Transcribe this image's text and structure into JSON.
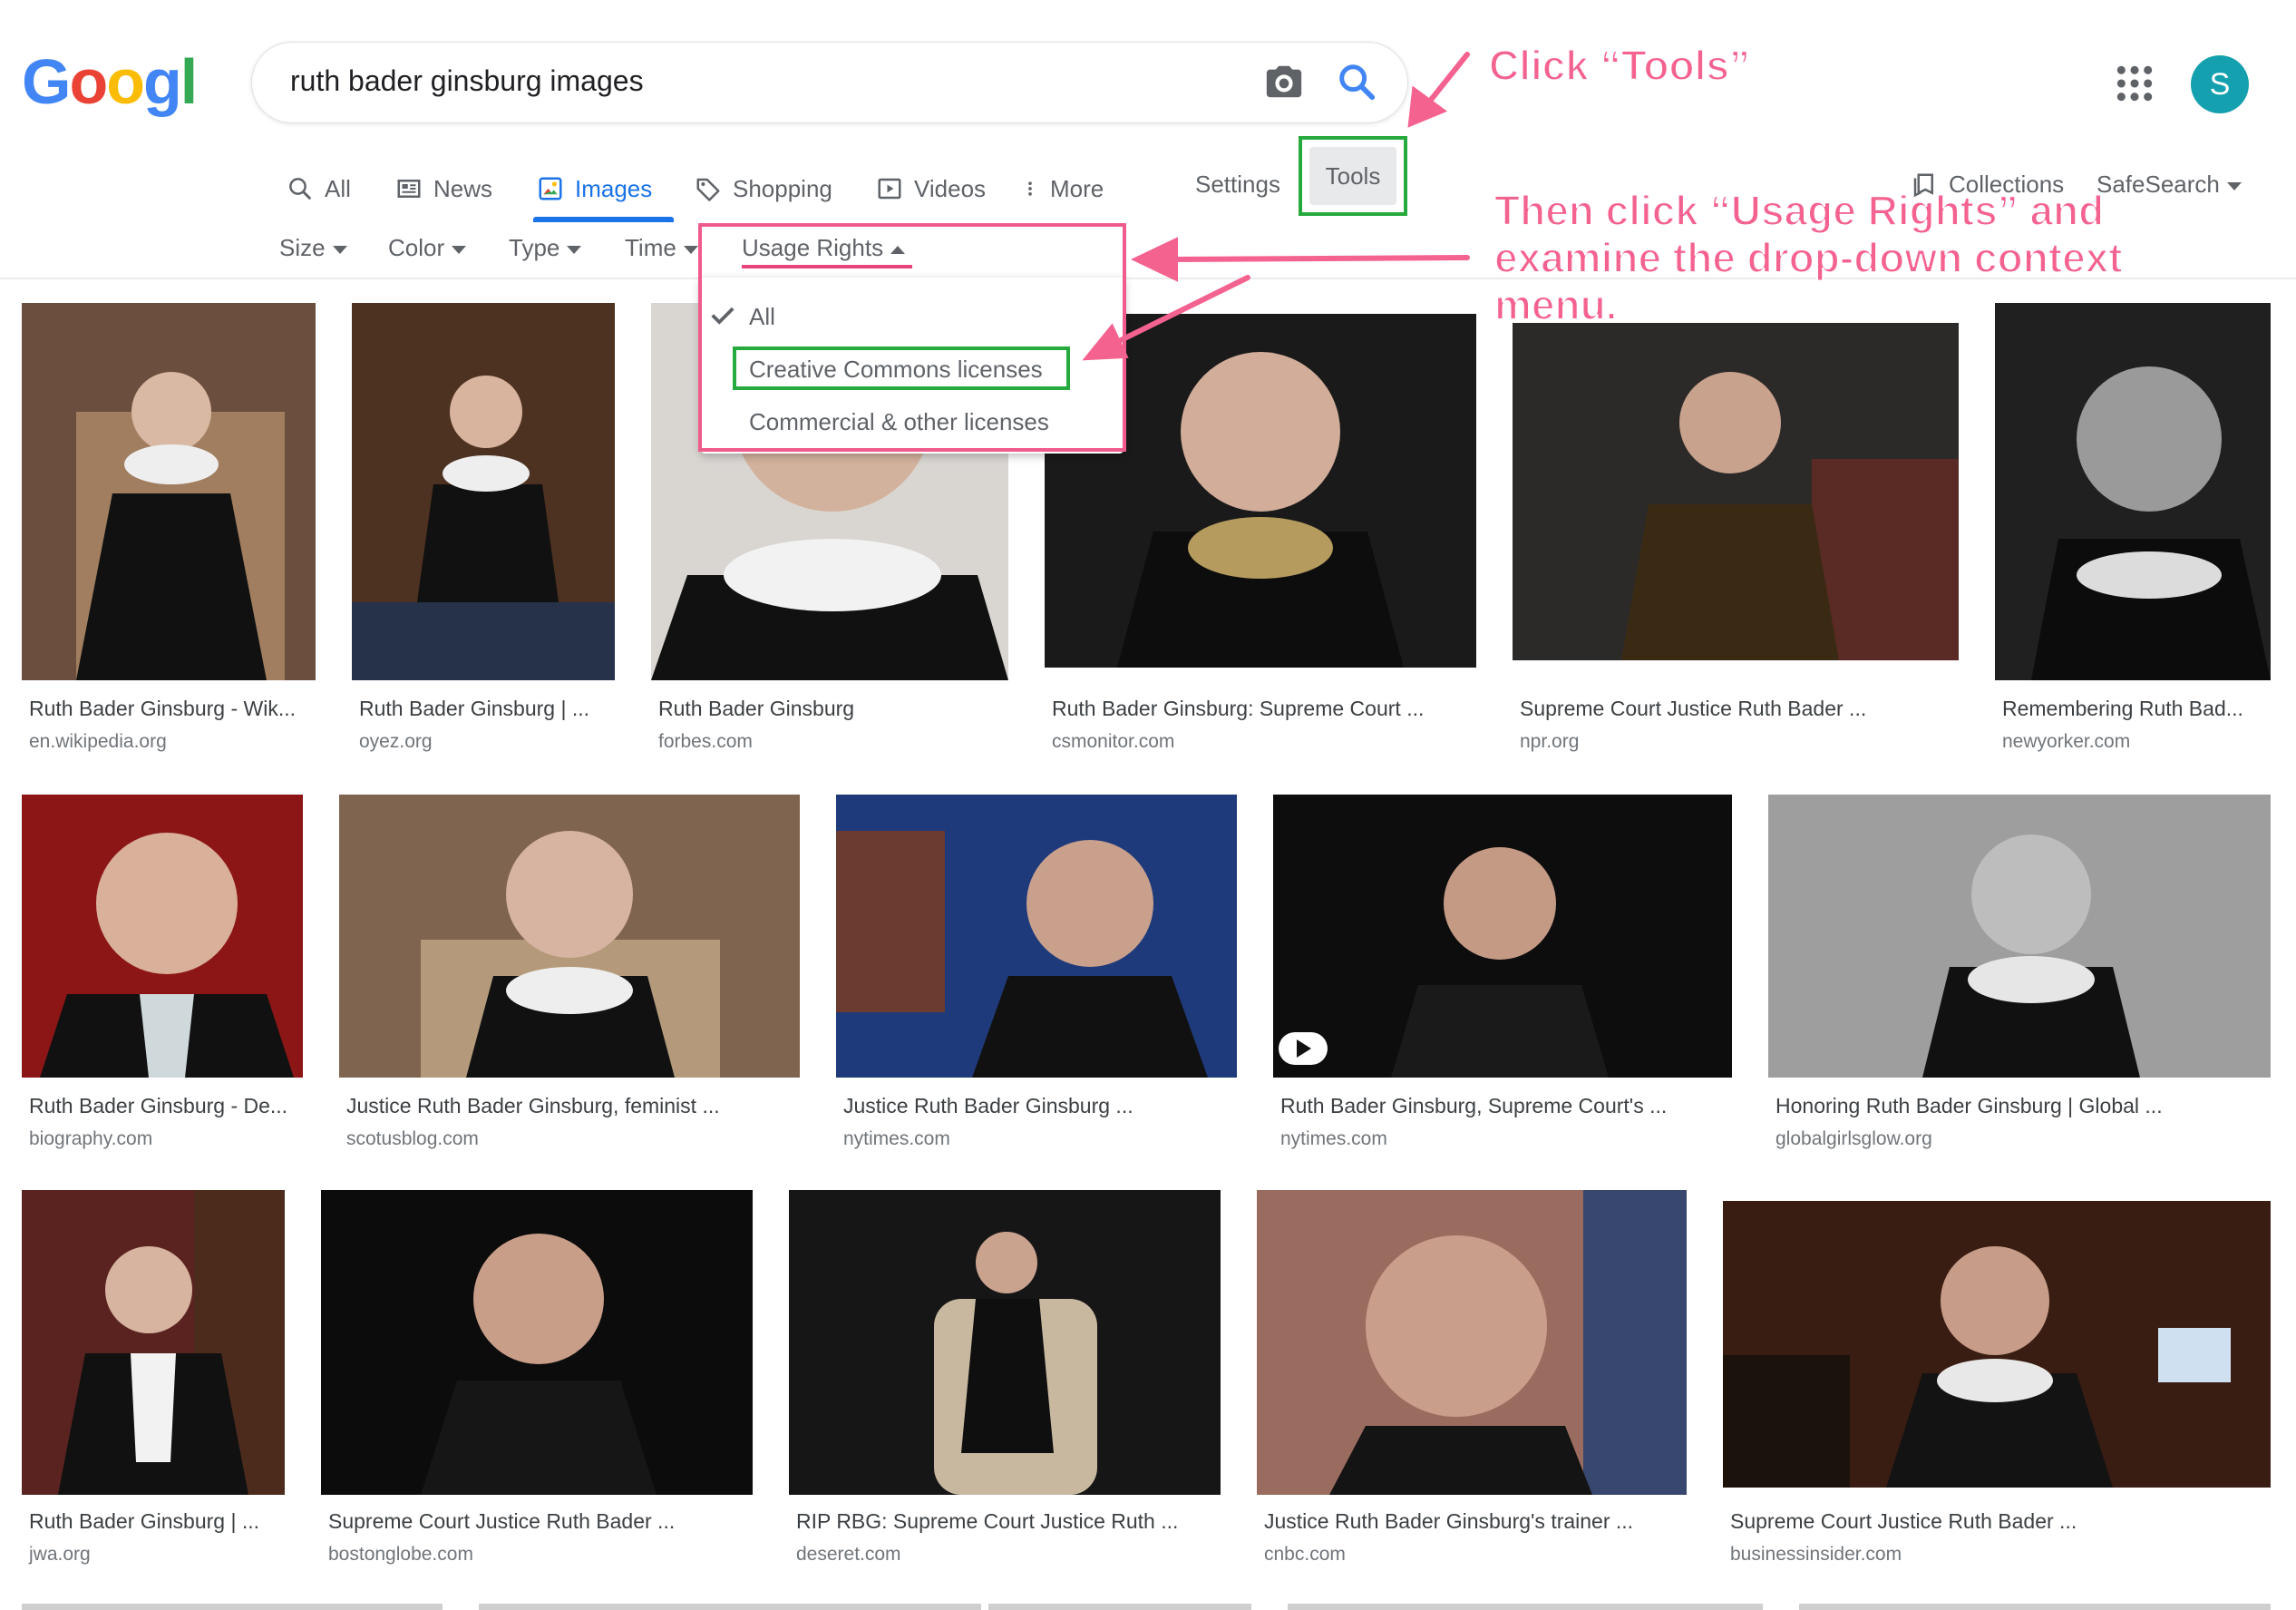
{
  "search": {
    "query": "ruth bader ginsburg images"
  },
  "user": {
    "avatar_initial": "S"
  },
  "nav": {
    "tabs": [
      {
        "label": "All",
        "icon": "search-icon"
      },
      {
        "label": "News",
        "icon": "news-icon"
      },
      {
        "label": "Images",
        "icon": "images-icon",
        "active": true
      },
      {
        "label": "Shopping",
        "icon": "tag-icon"
      },
      {
        "label": "Videos",
        "icon": "video-icon"
      },
      {
        "label": "More",
        "icon": "more-vert-icon"
      }
    ],
    "settings": "Settings",
    "tools": "Tools",
    "collections": "Collections",
    "safesearch": "SafeSearch"
  },
  "filters": {
    "size": "Size",
    "color": "Color",
    "type": "Type",
    "time": "Time",
    "usage_rights": "Usage Rights"
  },
  "usage_menu": {
    "items": [
      {
        "label": "All",
        "checked": true
      },
      {
        "label": "Creative Commons licenses",
        "highlighted": true
      },
      {
        "label": "Commercial & other licenses"
      }
    ]
  },
  "annotations": {
    "step1": "Click “Tools”",
    "step2_line1": "Then click “Usage Rights” and",
    "step2_line2": "examine the drop-down context",
    "step2_line3": "menu."
  },
  "colors": {
    "annotation_pink": "#f4628f",
    "highlight_green": "#26a93d",
    "google_blue": "#1a73e8",
    "avatar_teal": "#14a0ae"
  },
  "results": {
    "row1": [
      {
        "title": "Ruth Bader Ginsburg - Wik...",
        "source": "en.wikipedia.org"
      },
      {
        "title": "Ruth Bader Ginsburg | ...",
        "source": "oyez.org"
      },
      {
        "title": "Ruth Bader Ginsburg",
        "source": "forbes.com"
      },
      {
        "title": "Ruth Bader Ginsburg: Supreme Court ...",
        "source": "csmonitor.com"
      },
      {
        "title": "Supreme Court Justice Ruth Bader ...",
        "source": "npr.org"
      },
      {
        "title": "Remembering Ruth Bad...",
        "source": "newyorker.com"
      }
    ],
    "row2": [
      {
        "title": "Ruth Bader Ginsburg - De...",
        "source": "biography.com"
      },
      {
        "title": "Justice Ruth Bader Ginsburg, feminist ...",
        "source": "scotusblog.com"
      },
      {
        "title": "Justice Ruth Bader Ginsburg ...",
        "source": "nytimes.com"
      },
      {
        "title": "Ruth Bader Ginsburg, Supreme Court's ...",
        "source": "nytimes.com"
      },
      {
        "title": "Honoring Ruth Bader Ginsburg | Global ...",
        "source": "globalgirlsglow.org"
      }
    ],
    "row3": [
      {
        "title": "Ruth Bader Ginsburg | ...",
        "source": "jwa.org"
      },
      {
        "title": "Supreme Court Justice Ruth Bader ...",
        "source": "bostonglobe.com"
      },
      {
        "title": "RIP RBG: Supreme Court Justice Ruth ...",
        "source": "deseret.com"
      },
      {
        "title": "Justice Ruth Bader Ginsburg's trainer ...",
        "source": "cnbc.com"
      },
      {
        "title": "Supreme Court Justice Ruth Bader ...",
        "source": "businessinsider.com"
      }
    ]
  }
}
